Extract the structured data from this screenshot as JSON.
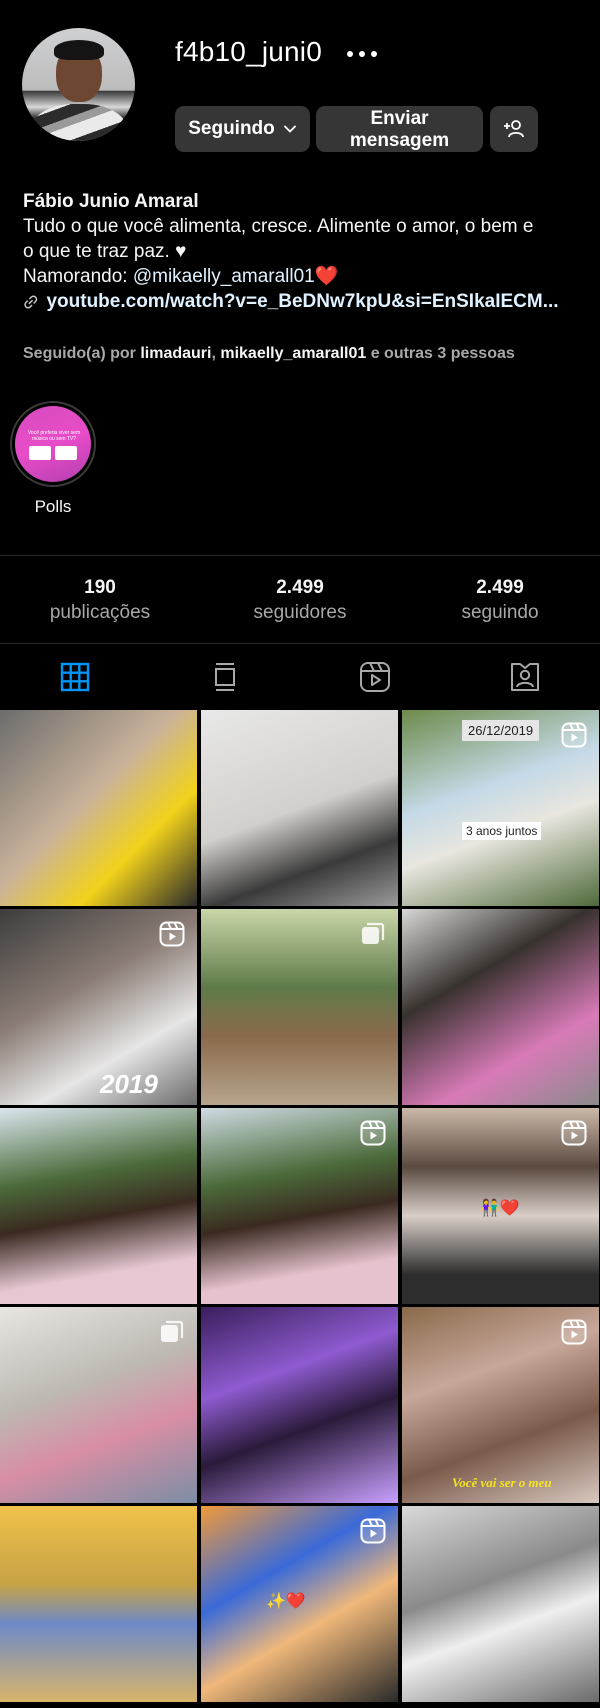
{
  "profile": {
    "username": "f4b10_juni0",
    "display_name": "Fábio Junio Amaral",
    "bio_line1": "Tudo o que você alimenta, cresce. Alimente o amor, o bem e",
    "bio_line2": "o que te traz paz. ♥",
    "dating_prefix": "Namorando: ",
    "dating_mention": "@mikaelly_amarall01",
    "dating_heart": "❤️",
    "link": "youtube.com/watch?v=e_BeDNw7kpU&si=EnSIkaIECM...",
    "followed_prefix": "Seguido(a) por ",
    "followed_user1": "limadauri",
    "followed_sep": ", ",
    "followed_user2": "mikaelly_amarall01",
    "followed_suffix": " e outras 3 pessoas"
  },
  "actions": {
    "following_label": "Seguindo",
    "message_line1": "Enviar",
    "message_line2": "mensagem"
  },
  "highlight": {
    "label": "Polls",
    "cover_text": "Você preferia viver sem música ou sem TV?"
  },
  "stats": [
    {
      "num": "190",
      "label": "publicações"
    },
    {
      "num": "2.499",
      "label": "seguidores"
    },
    {
      "num": "2.499",
      "label": "seguindo"
    }
  ],
  "tabs": [
    "grid-icon",
    "feed-icon",
    "reels-icon",
    "tagged-icon"
  ],
  "posts": [
    {
      "bg": "linear-gradient(135deg,#6c6c6c,#c9b29a 45%,#f2d21b 70%,#2a2a2a)",
      "badge": "none"
    },
    {
      "bg": "linear-gradient(160deg,#e8e8e8,#d2d0cc 50%,#3a3a3a 75%,#9a9a9a)",
      "badge": "none"
    },
    {
      "bg": "linear-gradient(160deg,#6d8a4a,#c4d9e6 40%,#e8e6df 60%,#4f6a3a)",
      "badge": "reel",
      "caption_date": "26/12/2019",
      "caption_text": "3 anos juntos"
    },
    {
      "bg": "linear-gradient(150deg,#3d3d3d,#8a7c74 40%,#e6e6e6 70%,#6a6a6a)",
      "badge": "reel",
      "caption_year": "2019"
    },
    {
      "bg": "linear-gradient(180deg,#c9d6a8,#5f7a4a 40%,#8a6a4c 65%,#b7a58b)",
      "badge": "multi"
    },
    {
      "bg": "linear-gradient(150deg,#d7d7d7,#38322e 35%,#d87ab8 70%,#8b8b8b)",
      "badge": "none"
    },
    {
      "bg": "linear-gradient(170deg,#dbe6ee,#4b6a3a 35%,#3a2a20 55%,#e6c7d2 80%)",
      "badge": "none"
    },
    {
      "bg": "linear-gradient(170deg,#cfdbe3,#4b6a3a 35%,#3a2a20 55%,#e5c2cd 80%)",
      "badge": "reel"
    },
    {
      "bg": "linear-gradient(180deg,#cbb8a8,#5a4a40 30%,#d9cfc8 55%,#2d2d2d 85%)",
      "badge": "reel",
      "caption_emoji": "👫❤️"
    },
    {
      "bg": "linear-gradient(160deg,#e8e6e2,#bdb8b2 40%,#d88ea4 65%,#7b8ea5)",
      "badge": "multi"
    },
    {
      "bg": "linear-gradient(160deg,#3a1e5c,#8e5bd0 35%,#2a1a3a 60%,#c9a0ff)",
      "badge": "none"
    },
    {
      "bg": "linear-gradient(160deg,#8a6a4a,#c7a79a 35%,#7a5a4a 65%,#d8c8c0)",
      "badge": "reel",
      "caption_italic": "Você vai ser o meu"
    },
    {
      "bg": "linear-gradient(180deg,#f0c24a,#c6a247 40%,#6d8ac8 60%,#d9b46a)",
      "badge": "none"
    },
    {
      "bg": "linear-gradient(150deg,#f19a3a,#3a6ad8 35%,#f0b87a 60%,#2a2a2a)",
      "badge": "reel",
      "caption_emoji": "✨❤️"
    },
    {
      "bg": "linear-gradient(160deg,#d9d9d9,#8a8a8a 40%,#efefef 60%,#6a6a6a)",
      "badge": "none"
    }
  ],
  "colors": {
    "background": "#000000",
    "button": "#363636",
    "link": "#e0f1ff",
    "muted": "#a8a8a8",
    "active_tab": "#0095f6",
    "heart": "#ed3b3b"
  }
}
